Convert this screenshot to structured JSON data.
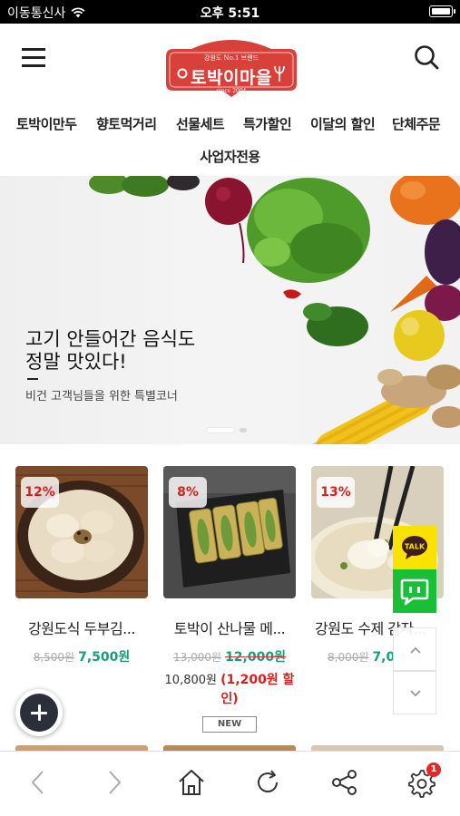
{
  "status_bar": {
    "carrier": "이동통신사",
    "time": "오후 5:51"
  },
  "header": {
    "logo": {
      "sub": "강원도 No.1 브랜드",
      "name": "토박이마을",
      "since": "since 2004"
    }
  },
  "nav": {
    "items": [
      "토박이만두",
      "향토먹거리",
      "선물세트",
      "특가할인",
      "이달의 할인",
      "단체주문",
      "사업자전용"
    ]
  },
  "banner": {
    "headline": "고기 안들어간 음식도\n정말 맛있다!",
    "subline": "비건 고객님들을 위한 특별코너",
    "slide_count": 2,
    "active_slide": 1
  },
  "products": [
    {
      "badge": "12%",
      "title": "강원도식 두부김...",
      "old_price": "8,500원",
      "price": "7,500원"
    },
    {
      "badge": "8%",
      "title": "토박이 산나물 메...",
      "old_price": "13,000원",
      "price": "12,000원",
      "member_price": "10,800원",
      "member_discount": "(1,200원 할인)",
      "tag": "NEW"
    },
    {
      "badge": "13%",
      "title": "강원도 수제 감자...",
      "old_price": "8,000원",
      "price": "7,0"
    }
  ],
  "floating": {
    "kakao_label": "TALK"
  },
  "toolbar": {
    "settings_badge": "1"
  },
  "colors": {
    "brand_red": "#d8403a",
    "sale_green": "#11a07a",
    "discount_red": "#d62020",
    "kakao_yellow": "#fae100",
    "chat_green": "#19c037"
  }
}
